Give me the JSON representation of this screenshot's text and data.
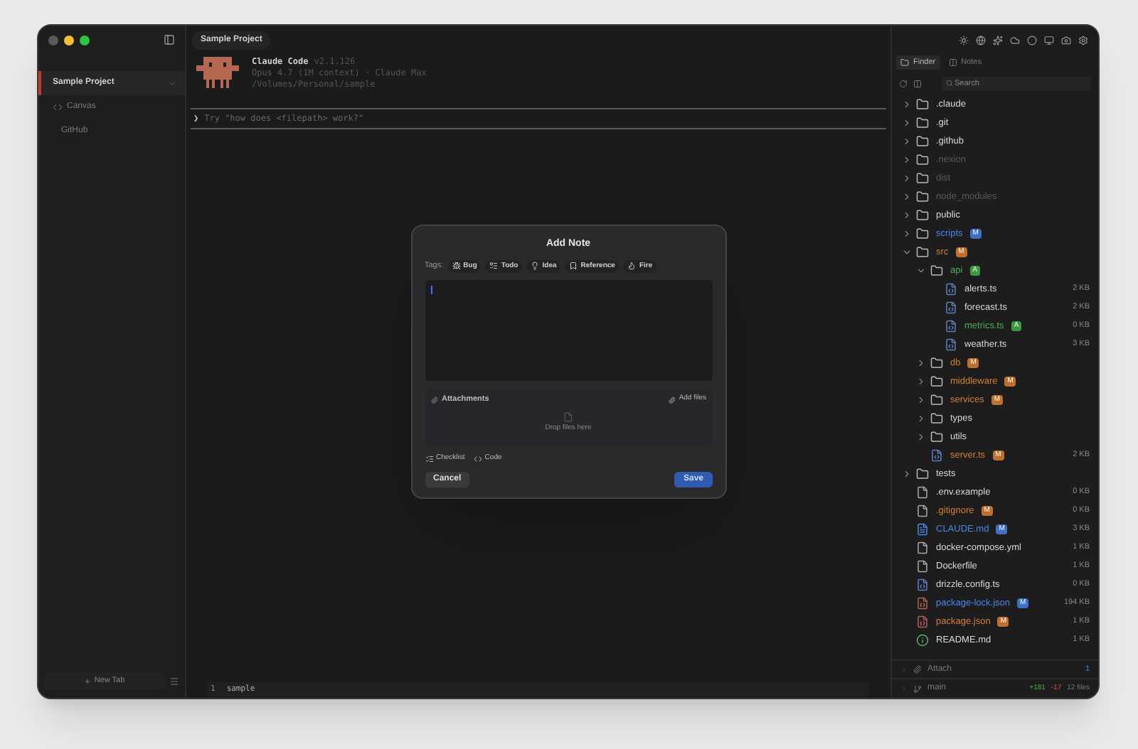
{
  "window": {
    "tab": "Sample Project"
  },
  "sidebar": {
    "items": [
      {
        "label": "Sample Project",
        "selected": true,
        "kind": "project"
      },
      {
        "label": "Canvas",
        "selected": false,
        "kind": "canvas"
      },
      {
        "label": "GitHub",
        "selected": false,
        "kind": "plain"
      }
    ],
    "new_tab": "New Tab"
  },
  "terminal": {
    "title": "Claude Code",
    "version": "v2.1.126",
    "model": "Opus 4.7 (1M context) · Claude Max",
    "path": "/Volumes/Personal/sample",
    "prompt_symbol": "❯",
    "prompt_placeholder": "Try \"how does <filepath> work?\"",
    "line_number": "1",
    "line_text": "sample"
  },
  "panel": {
    "tabs": [
      {
        "label": "Finder",
        "selected": true
      },
      {
        "label": "Notes",
        "selected": false
      }
    ],
    "search": {
      "placeholder": "Search"
    },
    "tree": [
      {
        "name": ".claude",
        "kind": "folder",
        "expanded": false,
        "color": "#d8d8d8"
      },
      {
        "name": ".git",
        "kind": "folder",
        "expanded": false,
        "color": "#d8d8d8"
      },
      {
        "name": ".github",
        "kind": "folder",
        "expanded": false,
        "color": "#d8d8d8"
      },
      {
        "name": ".nexion",
        "kind": "folder",
        "expanded": false,
        "color": "#5a5a5a"
      },
      {
        "name": "dist",
        "kind": "folder",
        "expanded": false,
        "color": "#5a5a5a"
      },
      {
        "name": "node_modules",
        "kind": "folder",
        "expanded": false,
        "color": "#5a5a5a"
      },
      {
        "name": "public",
        "kind": "folder",
        "expanded": false,
        "color": "#d8d8d8"
      },
      {
        "name": "scripts",
        "kind": "folder",
        "expanded": false,
        "color": "#4a86e8",
        "badge": {
          "text": "M",
          "color": "#3f6fc4"
        }
      },
      {
        "name": "src",
        "kind": "folder",
        "expanded": true,
        "color": "#d0802e",
        "badge": {
          "text": "M",
          "color": "#c0702a"
        },
        "children": [
          {
            "name": "api",
            "kind": "folder",
            "expanded": true,
            "color": "#4caf50",
            "badge": {
              "text": "A",
              "color": "#3d9a3f"
            },
            "children": [
              {
                "name": "alerts.ts",
                "kind": "ts",
                "color": "#d8d8d8",
                "size": "2 KB"
              },
              {
                "name": "forecast.ts",
                "kind": "ts",
                "color": "#d8d8d8",
                "size": "2 KB"
              },
              {
                "name": "metrics.ts",
                "kind": "ts",
                "color": "#4caf50",
                "size": "0 KB",
                "badge": {
                  "text": "A",
                  "color": "#3d9a3f"
                }
              },
              {
                "name": "weather.ts",
                "kind": "ts",
                "color": "#d8d8d8",
                "size": "3 KB"
              }
            ]
          },
          {
            "name": "db",
            "kind": "folder",
            "expanded": false,
            "color": "#d0802e",
            "badge": {
              "text": "M",
              "color": "#c0702a"
            }
          },
          {
            "name": "middleware",
            "kind": "folder",
            "expanded": false,
            "color": "#d0802e",
            "badge": {
              "text": "M",
              "color": "#c0702a"
            }
          },
          {
            "name": "services",
            "kind": "folder",
            "expanded": false,
            "color": "#d0802e",
            "badge": {
              "text": "M",
              "color": "#c0702a"
            }
          },
          {
            "name": "types",
            "kind": "folder",
            "expanded": false,
            "color": "#d8d8d8"
          },
          {
            "name": "utils",
            "kind": "folder",
            "expanded": false,
            "color": "#d8d8d8"
          },
          {
            "name": "server.ts",
            "kind": "ts",
            "color": "#d0802e",
            "size": "2 KB",
            "badge": {
              "text": "M",
              "color": "#c0702a"
            }
          }
        ]
      },
      {
        "name": "tests",
        "kind": "folder",
        "expanded": false,
        "color": "#d8d8d8"
      },
      {
        "name": ".env.example",
        "kind": "file",
        "color": "#d8d8d8",
        "size": "0 KB"
      },
      {
        "name": ".gitignore",
        "kind": "file",
        "color": "#d0802e",
        "size": "0 KB",
        "badge": {
          "text": "M",
          "color": "#c0702a"
        }
      },
      {
        "name": "CLAUDE.md",
        "kind": "md",
        "color": "#4a86e8",
        "size": "3 KB",
        "badge": {
          "text": "M",
          "color": "#3f6fc4"
        }
      },
      {
        "name": "docker-compose.yml",
        "kind": "file",
        "color": "#d8d8d8",
        "size": "1 KB"
      },
      {
        "name": "Dockerfile",
        "kind": "file",
        "color": "#d8d8d8",
        "size": "1 KB"
      },
      {
        "name": "drizzle.config.ts",
        "kind": "ts",
        "color": "#d8d8d8",
        "size": "0 KB"
      },
      {
        "name": "package-lock.json",
        "kind": "json",
        "color": "#4a86e8",
        "size": "194 KB",
        "badge": {
          "text": "M",
          "color": "#3f6fc4"
        }
      },
      {
        "name": "package.json",
        "kind": "json",
        "color": "#d0802e",
        "size": "1 KB",
        "badge": {
          "text": "M",
          "color": "#c0702a"
        }
      },
      {
        "name": "README.md",
        "kind": "info",
        "color": "#d8d8d8",
        "size": "1 KB"
      }
    ],
    "attach": {
      "label": "Attach",
      "count": "1"
    },
    "git": {
      "branch": "main",
      "added": "+181",
      "removed": "-17",
      "files": "12 files"
    }
  },
  "dialog": {
    "title": "Add Note",
    "tags_label": "Tags:",
    "tags": [
      {
        "label": "Bug",
        "kind": "bug"
      },
      {
        "label": "Todo",
        "kind": "todo"
      },
      {
        "label": "Idea",
        "kind": "idea"
      },
      {
        "label": "Reference",
        "kind": "reference"
      },
      {
        "label": "Fire",
        "kind": "fire"
      }
    ],
    "attachments": "Attachments",
    "add_files": "Add files",
    "drop": "Drop files here",
    "tools": [
      {
        "label": "Checklist",
        "kind": "checklist"
      },
      {
        "label": "Code",
        "kind": "code"
      }
    ],
    "cancel": "Cancel",
    "save": "Save"
  }
}
